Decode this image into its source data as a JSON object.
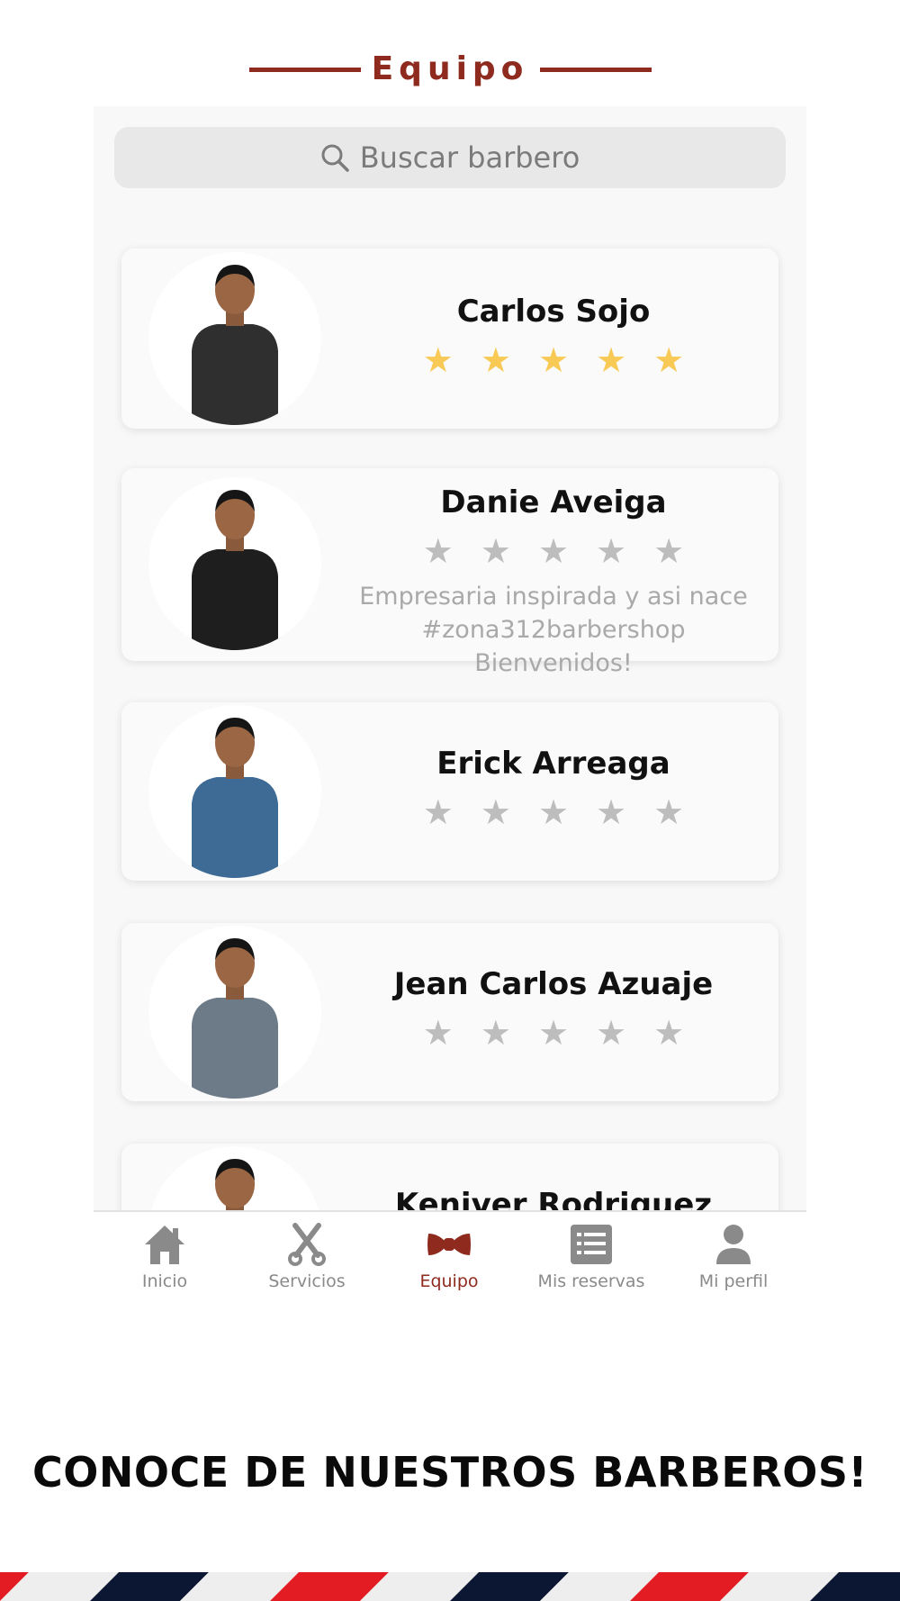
{
  "header": {
    "title": "Equipo"
  },
  "search": {
    "placeholder": "Buscar barbero",
    "icon": "search-icon"
  },
  "barbers": [
    {
      "name": "Carlos Sojo",
      "rating": 5,
      "max_rating": 5,
      "bio": ""
    },
    {
      "name": "Danie Aveiga",
      "rating": 0,
      "max_rating": 5,
      "bio": "Empresaria inspirada y asi nace #zona312barbershop Bienvenidos!"
    },
    {
      "name": "Erick Arreaga",
      "rating": 0,
      "max_rating": 5,
      "bio": ""
    },
    {
      "name": "Jean Carlos Azuaje",
      "rating": 0,
      "max_rating": 5,
      "bio": ""
    },
    {
      "name": "Keniver Rodriguez",
      "rating": 0,
      "max_rating": 5,
      "bio": ""
    }
  ],
  "tabs": [
    {
      "label": "Inicio",
      "icon": "home-icon",
      "active": false
    },
    {
      "label": "Servicios",
      "icon": "scissors-icon",
      "active": false
    },
    {
      "label": "Equipo",
      "icon": "bowtie-icon",
      "active": true
    },
    {
      "label": "Mis reservas",
      "icon": "list-icon",
      "active": false
    },
    {
      "label": "Mi perfil",
      "icon": "user-icon",
      "active": false
    }
  ],
  "banner": {
    "headline": "CONOCE DE NUESTROS BARBEROS!"
  },
  "colors": {
    "accent": "#8e2b1e",
    "star_filled": "#f8c955",
    "star_empty": "#bdbdbd",
    "stripe_red": "#e31b23",
    "stripe_navy": "#0c1833",
    "stripe_white": "#eeeeee"
  }
}
